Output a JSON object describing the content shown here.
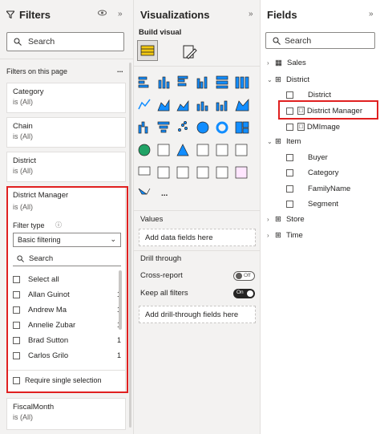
{
  "filters": {
    "title": "Filters",
    "search_placeholder": "Search",
    "section_label": "Filters on this page",
    "section_more": "...",
    "cards": [
      {
        "name": "Category",
        "value": "is (All)"
      },
      {
        "name": "Chain",
        "value": "is (All)"
      },
      {
        "name": "District",
        "value": "is (All)"
      }
    ],
    "expanded": {
      "name": "District Manager",
      "value": "is (All)",
      "filter_type_label": "Filter type",
      "filter_type_value": "Basic filtering",
      "search_placeholder": "Search",
      "items": [
        {
          "label": "Select all",
          "count": ""
        },
        {
          "label": "Allan Guinot",
          "count": "1"
        },
        {
          "label": "Andrew Ma",
          "count": "1"
        },
        {
          "label": "Annelie Zubar",
          "count": "1"
        },
        {
          "label": "Brad Sutton",
          "count": "1"
        },
        {
          "label": "Carlos Grilo",
          "count": "1"
        }
      ],
      "require_single": "Require single selection"
    },
    "bottom_card": {
      "name": "FiscalMonth",
      "value": "is (All)"
    }
  },
  "visualizations": {
    "title": "Visualizations",
    "build_label": "Build visual",
    "values_label": "Values",
    "values_placeholder": "Add data fields here",
    "drill_label": "Drill through",
    "cross_report_label": "Cross-report",
    "cross_report_state": "Off",
    "keep_filters_label": "Keep all filters",
    "keep_filters_state": "On",
    "drill_placeholder": "Add drill-through fields here",
    "more": "...",
    "accent": "#f2c811"
  },
  "fields": {
    "title": "Fields",
    "search_placeholder": "Search",
    "tables": [
      {
        "name": "Sales",
        "expanded": false
      },
      {
        "name": "District",
        "expanded": true,
        "fields": [
          "District",
          "District Manager",
          "DMImage"
        ]
      },
      {
        "name": "Item",
        "expanded": true,
        "fields": [
          "Buyer",
          "Category",
          "FamilyName",
          "Segment"
        ]
      },
      {
        "name": "Store",
        "expanded": false
      },
      {
        "name": "Time",
        "expanded": false
      }
    ]
  }
}
